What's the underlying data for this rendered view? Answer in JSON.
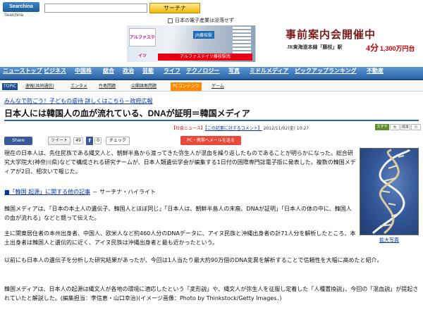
{
  "header": {
    "logo_text": "Searchina",
    "logo_sub": "Searchina",
    "search_button": "サーチナ",
    "search_value": "",
    "ticker": "日本の電子産業は没落せず"
  },
  "ads": {
    "left_brand": "アルファステイツ",
    "left_label": "JR藤枝駅",
    "left_strip": "アルファステイツ藤枝駅南",
    "right_headline": "事前案内会開催中",
    "right_place": "JR東海道本線「藤枝」駅",
    "right_walk": "4分",
    "right_price": "1,300万円台"
  },
  "nav": {
    "items": [
      "ニューストップ",
      "ビジネス",
      "中国株",
      "総合",
      "政治",
      "芸能",
      "ライフ",
      "テクノロジー",
      "写真",
      "ミドルメディア",
      "ピックアップ",
      "ランキング",
      "不動産"
    ]
  },
  "subnav": {
    "topic_label": "TOPIC",
    "items": [
      "速報(共同通信)",
      "エンタメ",
      "竹島問題",
      "尖閣諸島問題"
    ],
    "highlight": "PCコンテンツ",
    "last": "ゲーム"
  },
  "promo_link": "みんなで防ごう！子どもの虐待 詳しくはこちら－政府広報",
  "article": {
    "title": "日本人には韓国人の血が流れている、DNAが証明＝韓国メディア",
    "category": "【社会ニュース】",
    "comment_link": "【この記事に対するコメント】",
    "timestamp": "2012/11/02(金) 10:27",
    "para1": "現在の日本人は、先住民族である縄文人と、朝鮮半島から渡ってきた弥生人が混血を繰り返したものであることが明らかになった。総合研究大学院大(神奈川県)などで構成される研究チームが、日本人類遺伝学会が編集する1日付の国際専門誌電子版に発表した。複数の韓国メディアが2日、相次いで報じた。",
    "related_link": "■「韓国 起源」に関する他の記事",
    "related_suffix": " － サーチナ・ハイライト",
    "para2": "韓国メディアは、「日本の本土人の遺伝子、韓国人とほぼ同じ」「日本人は、朝鮮半島人の末裔、DNAが証明」「日本人の体の中に、韓国人の血が流れる」などと競って伝えた。",
    "para3": "主に関東居住者の本州出身者、中国人、欧米人など約460人分のDNAデータに、アイヌ民族と沖縄出身者の計71人分を解析したところ、本土出身者は韓国人と遺伝的に近く、アイヌ民族は沖縄出身者と最も近かったという。",
    "para4": "以前にも日本人の遺伝子を分析した研究結果があったが、今回は1人当たり最大約90万個のDNA変異を解析することで信頼性を大幅に高めたと紹介。",
    "para5": "韓国メディアは、日本人の起源は縄文人が各地の環境に適応したという「変形説」や、縄文人が弥生人を征服し定着した「人種置換説」、今回の「混血説」が提起されていたと解説した。(編集担当：李信恵・山口幸治)(イメージ画像：Photo by Thinkstock/Getty Images．)",
    "photo_caption": "拡大写真"
  },
  "share": {
    "share_label": "Share",
    "tweet_label": "ツイート",
    "tweet_count": "49",
    "fb_count": "0",
    "check_label": "チェック",
    "mail_label": "PC・携帯へメールを送る"
  },
  "textsize": {
    "label": "文字サイズ",
    "options": [
      "大",
      "標準",
      "小"
    ]
  },
  "colors": {
    "nav_bg": "#2b63a8",
    "accent_red": "#e7493a",
    "link": "#0033aa",
    "search_button": "#f4b900"
  }
}
